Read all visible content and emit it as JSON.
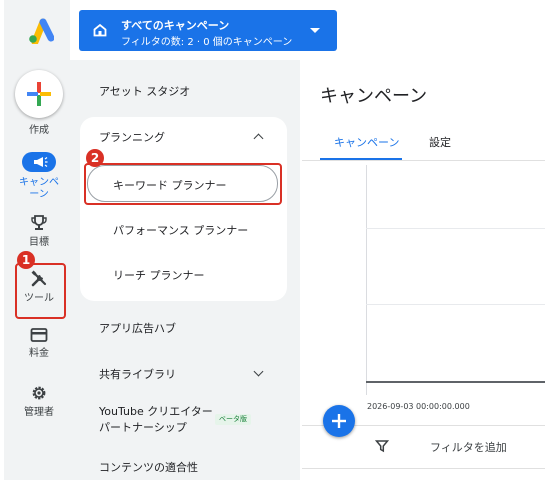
{
  "campaign_selector": {
    "title": "すべてのキャンペーン",
    "subtitle": "フィルタの数: 2 · 0 個のキャンペーン"
  },
  "rail": {
    "create_label": "作成",
    "items": [
      {
        "label": "キャンペーン",
        "icon": "megaphone-icon",
        "active": true
      },
      {
        "label": "目標",
        "icon": "trophy-icon",
        "active": false
      },
      {
        "label": "ツール",
        "icon": "tools-icon",
        "active": false
      },
      {
        "label": "料金",
        "icon": "credit-card-icon",
        "active": false
      },
      {
        "label": "管理者",
        "icon": "gear-icon",
        "active": false
      }
    ]
  },
  "tools_panel": {
    "asset_studio": "アセット スタジオ",
    "planning": {
      "label": "プランニング",
      "expanded": true,
      "items": [
        "キーワード プランナー",
        "パフォーマンス プランナー",
        "リーチ プランナー"
      ]
    },
    "app_ad_hub": "アプリ広告ハブ",
    "shared_library": "共有ライブラリ",
    "youtube_partnership": "YouTube クリエイター パートナーシップ",
    "beta_badge": "ベータ版",
    "content_suitability": "コンテンツの適合性"
  },
  "badges": [
    "1",
    "2"
  ],
  "main": {
    "title": "キャンペーン",
    "tabs": [
      {
        "label": "キャンペーン",
        "active": true
      },
      {
        "label": "設定",
        "active": false
      }
    ],
    "date_label": "2026-09-03 00:00:00.000",
    "filter_label": "フィルタを追加"
  },
  "colors": {
    "accent": "#1a73e8",
    "highlight": "#d93025",
    "panel_bg": "#f1f3f4"
  }
}
